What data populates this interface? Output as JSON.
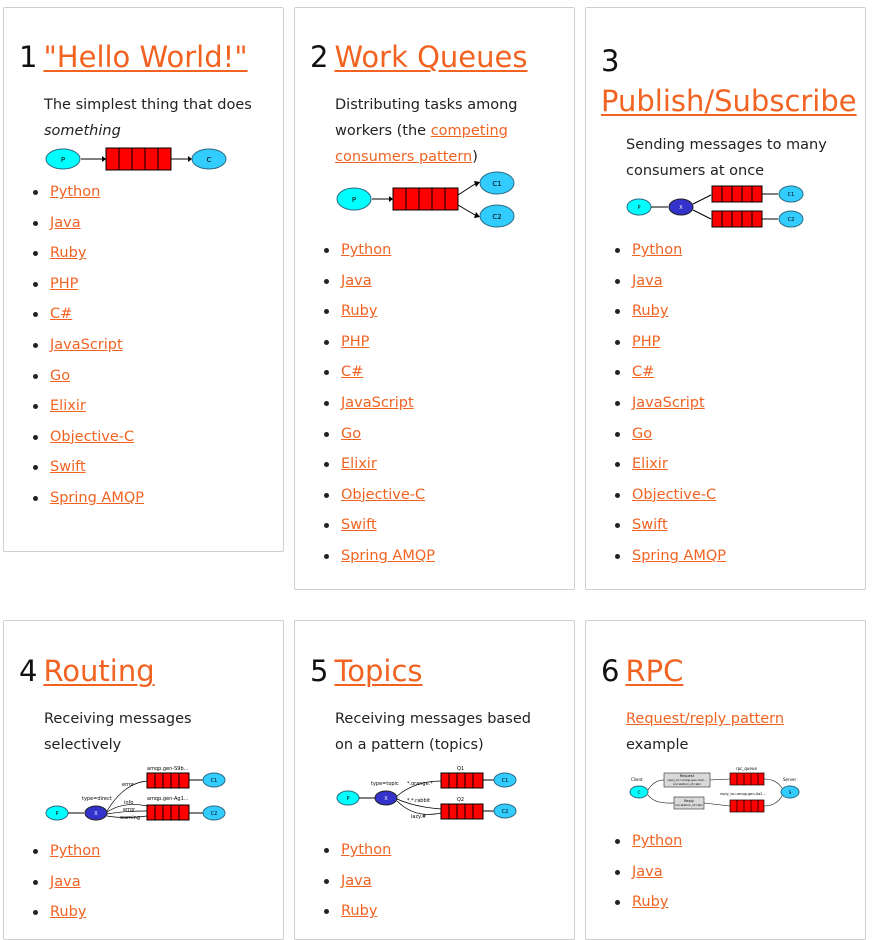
{
  "colors": {
    "link": "#f26322",
    "queue": "#ff0000",
    "producer": "#00ffff",
    "consumer": "#33ccff",
    "exchange": "#3333cc"
  },
  "langs11": [
    "Python",
    "Java",
    "Ruby",
    "PHP",
    "C#",
    "JavaScript",
    "Go",
    "Elixir",
    "Objective-C",
    "Swift",
    "Spring AMQP"
  ],
  "langs3": [
    "Python",
    "Java",
    "Ruby"
  ],
  "t1": {
    "num": "1",
    "title": "\"Hello World!\"",
    "desc": "The simplest thing that does",
    "desc_em": "something",
    "p": "P",
    "c": "C"
  },
  "t2": {
    "num": "2",
    "title": "Work Queues",
    "desc_a": "Distributing tasks among workers (the",
    "desc_link": "competing consumers pattern",
    "desc_b": ")",
    "p": "P",
    "c1": "C1",
    "c2": "C2"
  },
  "t3": {
    "num": "3",
    "title": "Publish/Subscribe",
    "desc": "Sending messages to many consumers at once",
    "p": "P",
    "x": "X",
    "c1": "C1",
    "c2": "C2"
  },
  "t4": {
    "num": "4",
    "title": "Routing",
    "desc": "Receiving messages selectively",
    "p": "P",
    "x": "X",
    "c1": "C1",
    "c2": "C2",
    "type": "type=direct",
    "q1": "amqp.gen-S9b...",
    "q2": "amqp.gen-Ag1...",
    "k_error": "error",
    "k_info": "info",
    "k_error2": "error",
    "k_warning": "warning"
  },
  "t5": {
    "num": "5",
    "title": "Topics",
    "desc": "Receiving messages based on a pattern (topics)",
    "p": "P",
    "x": "X",
    "c1": "C1",
    "c2": "C2",
    "type": "type=topic",
    "q1": "Q1",
    "q2": "Q2",
    "k1": "*.orange.*",
    "k2": "*.*.rabbit",
    "k3": "lazy.#"
  },
  "t6": {
    "num": "6",
    "title": "RPC",
    "desc_link": "Request/reply pattern",
    "desc_b": "example",
    "client": "Client",
    "server": "Server",
    "c": "C",
    "s": "S",
    "rpc_queue": "rpc_queue",
    "req": "Request",
    "req_detail": "reply_to=amqp.gen-Xa2...",
    "req_detail2": "correlation_id=abc",
    "reply": "Reply",
    "reply_detail": "correlation_id=abc",
    "reply_q": "reply_to=amqp.gen-Xa2..."
  }
}
